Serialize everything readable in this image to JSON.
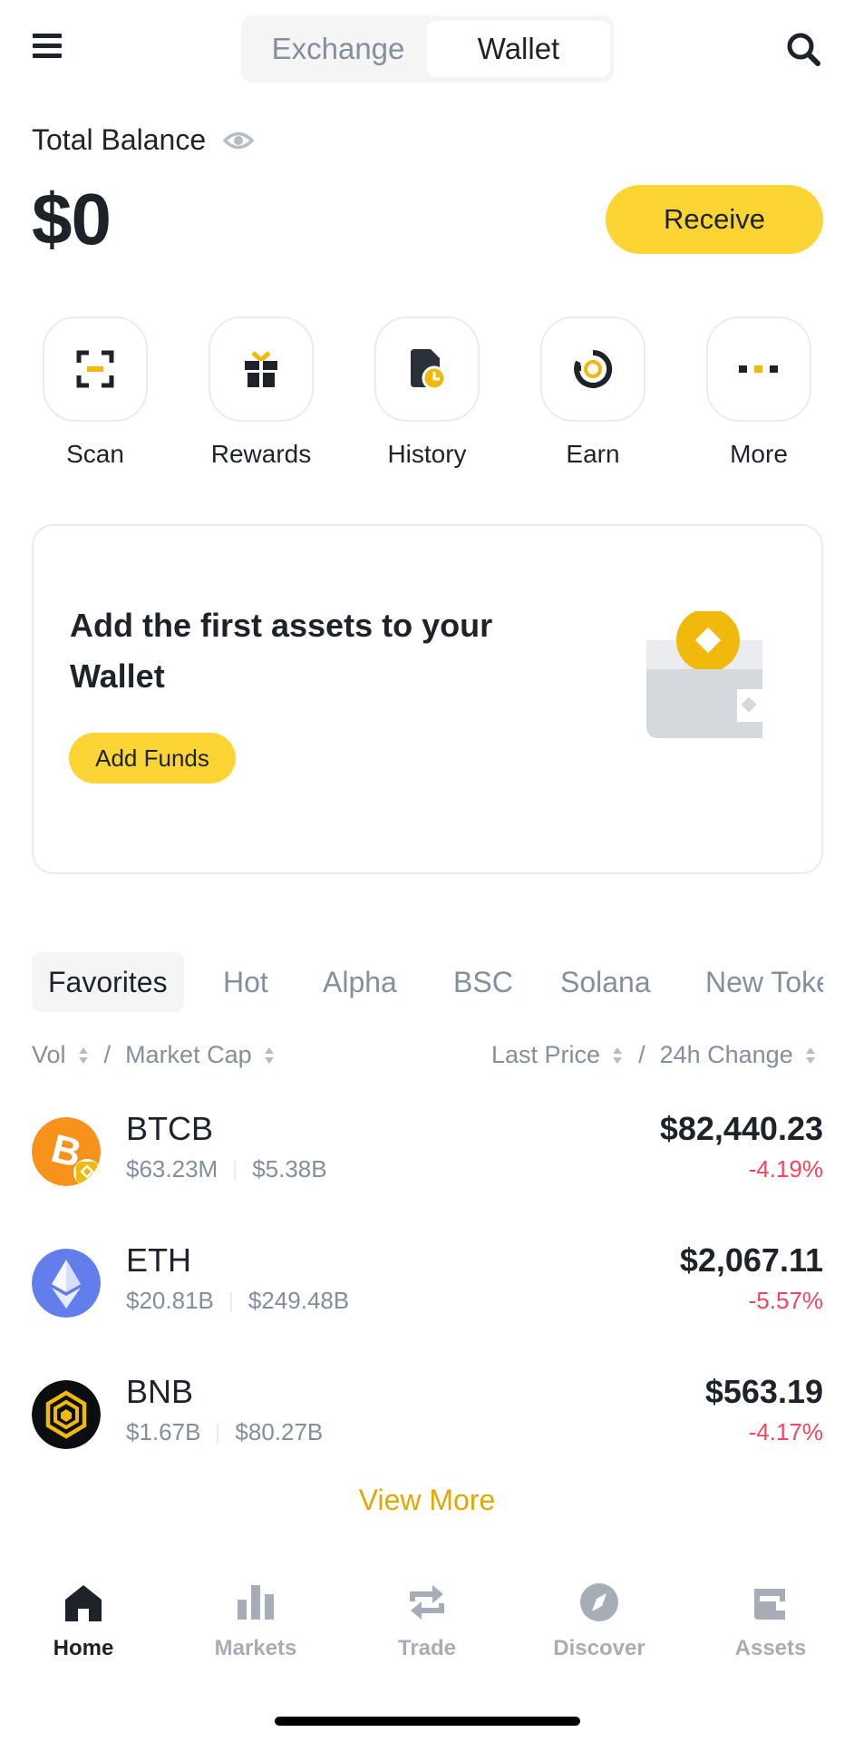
{
  "header": {
    "segments": [
      "Exchange",
      "Wallet"
    ],
    "active_segment": "Wallet",
    "icons": {
      "menu": "hamburger-menu-icon",
      "search": "search-icon"
    }
  },
  "balance": {
    "label": "Total Balance",
    "value": "$0",
    "receive_label": "Receive",
    "eye_icon": "eye-icon"
  },
  "quick_actions": [
    {
      "label": "Scan",
      "icon": "scan-icon"
    },
    {
      "label": "Rewards",
      "icon": "gift-icon"
    },
    {
      "label": "History",
      "icon": "history-icon"
    },
    {
      "label": "Earn",
      "icon": "earn-icon"
    },
    {
      "label": "More",
      "icon": "more-icon"
    }
  ],
  "promo": {
    "title": "Add the first assets to your Wallet",
    "button": "Add Funds",
    "illustration": "wallet-illustration"
  },
  "market_tabs": [
    "Favorites",
    "Hot",
    "Alpha",
    "BSC",
    "Solana",
    "New Tokens"
  ],
  "active_tab": "Favorites",
  "sort": {
    "left": [
      "Vol",
      "Market Cap"
    ],
    "right": [
      "Last Price",
      "24h Change"
    ]
  },
  "coins": [
    {
      "symbol": "BTCB",
      "volume": "$63.23M",
      "market_cap": "$5.38B",
      "price": "$82,440.23",
      "change": "-4.19%",
      "logo_color": "#f7931a"
    },
    {
      "symbol": "ETH",
      "volume": "$20.81B",
      "market_cap": "$249.48B",
      "price": "$2,067.11",
      "change": "-5.57%",
      "logo_color": "#627eea"
    },
    {
      "symbol": "BNB",
      "volume": "$1.67B",
      "market_cap": "$80.27B",
      "price": "$563.19",
      "change": "-4.17%",
      "logo_color": "#0b0e11"
    }
  ],
  "view_more": "View More",
  "bottom_nav": [
    {
      "label": "Home",
      "icon": "home-icon",
      "active": true
    },
    {
      "label": "Markets",
      "icon": "markets-icon",
      "active": false
    },
    {
      "label": "Trade",
      "icon": "trade-icon",
      "active": false
    },
    {
      "label": "Discover",
      "icon": "discover-icon",
      "active": false
    },
    {
      "label": "Assets",
      "icon": "assets-icon",
      "active": false
    }
  ],
  "colors": {
    "accent": "#fcd535",
    "text_primary": "#1e2329",
    "text_secondary": "#848e9c",
    "negative": "#f6465d",
    "link": "#e0a800"
  }
}
